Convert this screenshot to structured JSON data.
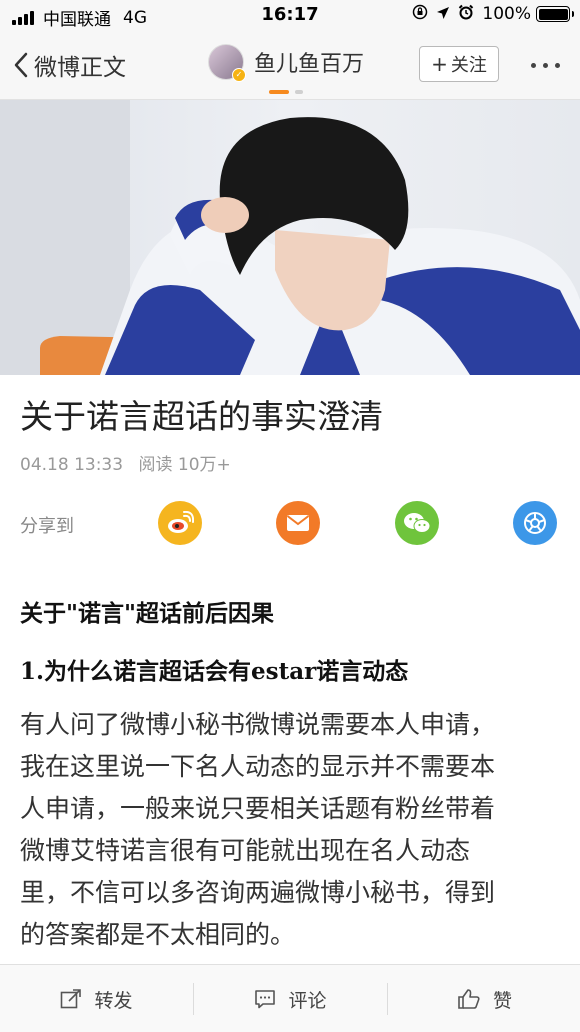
{
  "status_bar": {
    "carrier": "中国联通",
    "network": "4G",
    "time": "16:17",
    "battery": "100%"
  },
  "nav": {
    "back_label": "微博正文",
    "author_name": "鱼儿鱼百万",
    "follow_label": "关注"
  },
  "article": {
    "title": "关于诺言超话的事实澄清",
    "date": "04.18 13:33",
    "reads": "阅读 10万+",
    "share_label": "分享到",
    "heading1": "关于\"诺言\"超话前后因果",
    "heading2": "1.为什么诺言超话会有estar诺言动态",
    "body_lines": [
      "有人问了微博小秘书微博说需要本人申请，",
      "我在这里说一下名人动态的显示并不需要本",
      "人申请，一般来说只要相关话题有粉丝带着",
      "微博艾特诺言很有可能就出现在名人动态",
      "里，不信可以多咨询两遍微博小秘书，得到",
      "的答案都是不太相同的。"
    ]
  },
  "share_icons": [
    {
      "name": "weibo-share-icon",
      "color": "#f5b51f"
    },
    {
      "name": "mail-share-icon",
      "color": "#f27a28"
    },
    {
      "name": "wechat-share-icon",
      "color": "#6fc43c"
    },
    {
      "name": "moments-share-icon",
      "color": "#3c97e8"
    }
  ],
  "bottom_bar": {
    "repost_label": "转发",
    "comment_label": "评论",
    "like_label": "赞"
  }
}
